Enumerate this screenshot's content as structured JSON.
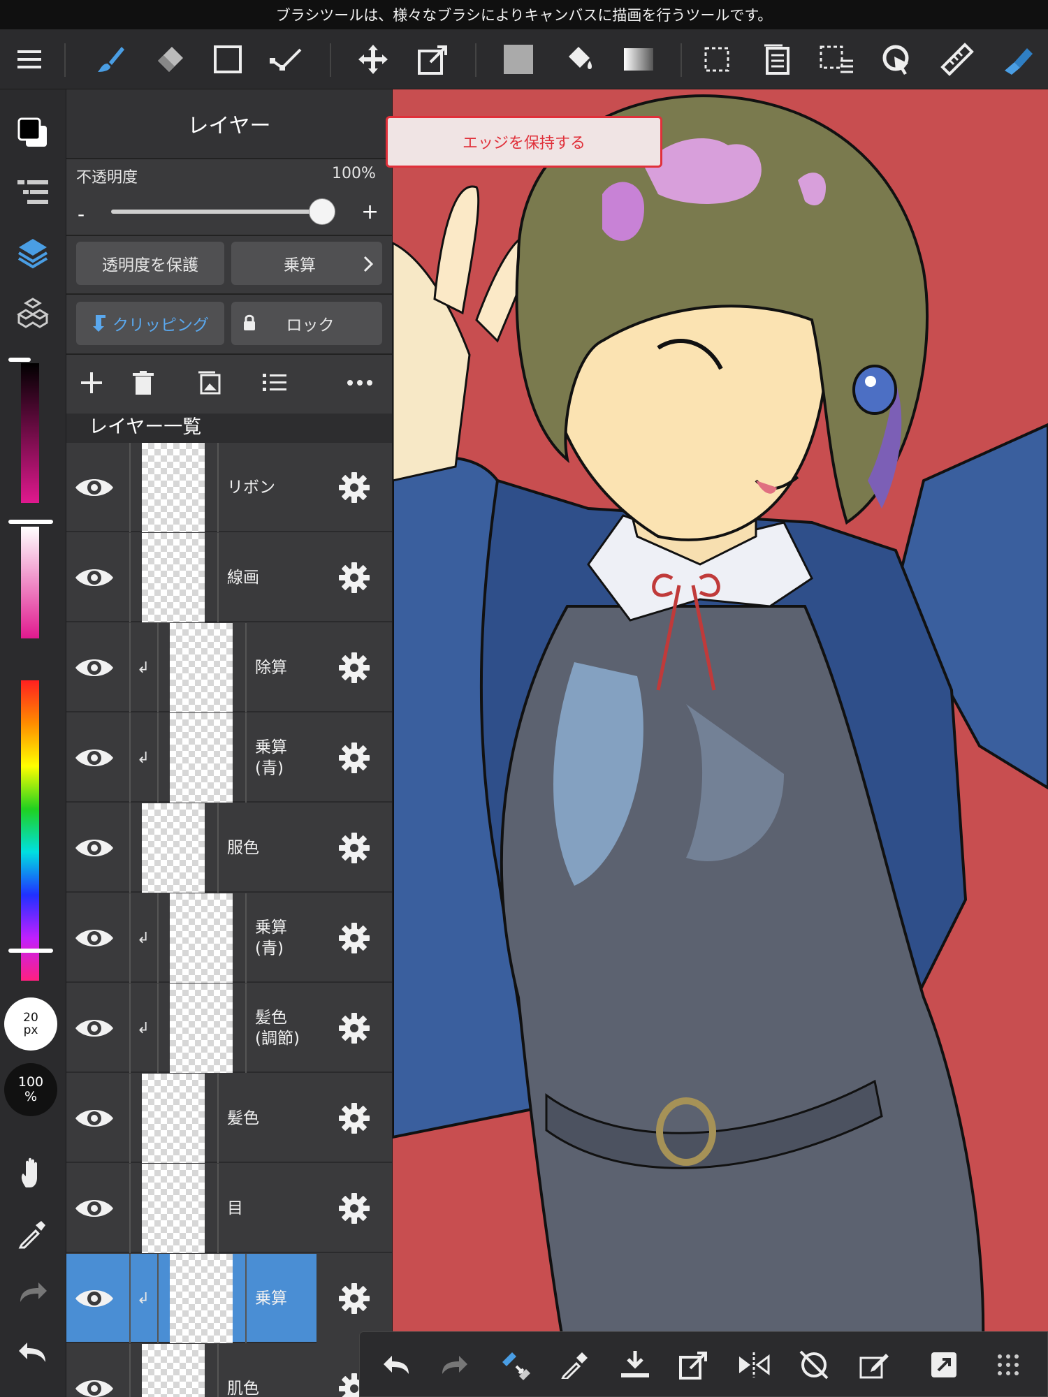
{
  "tip": "ブラシツールは、様々なブラシによりキャンバスに描画を行うツールです。",
  "toolbar": {
    "tools": [
      "menu-icon",
      "brush-icon",
      "eraser-icon",
      "rectangle-icon",
      "vertex-tool-icon",
      "move-icon",
      "transform-icon",
      "fill-color-icon",
      "bucket-icon",
      "gradient-icon",
      "select-rect-icon",
      "paste-icon",
      "selection-layer-icon",
      "lasso-icon",
      "ruler-icon",
      "current-brush-icon"
    ]
  },
  "panel": {
    "title": "レイヤー",
    "opacity_label": "不透明度",
    "opacity_value": "100%",
    "opacity_fraction": 1.0,
    "minus": "-",
    "plus": "+",
    "protect_alpha": "透明度を保護",
    "blend_mode": "乗算",
    "clipping": "クリッピング",
    "lock": "ロック",
    "list_title": "レイヤー一覧"
  },
  "layers": [
    {
      "name": "リボン",
      "clipped": false,
      "selected": false
    },
    {
      "name": "線画",
      "clipped": false,
      "selected": false
    },
    {
      "name": "除算",
      "clipped": true,
      "selected": false
    },
    {
      "name": "乗算\n(青)",
      "clipped": true,
      "selected": false
    },
    {
      "name": "服色",
      "clipped": false,
      "selected": false
    },
    {
      "name": "乗算\n(青)",
      "clipped": true,
      "selected": false
    },
    {
      "name": "髪色\n(調節)",
      "clipped": true,
      "selected": false
    },
    {
      "name": "髪色",
      "clipped": false,
      "selected": false
    },
    {
      "name": "目",
      "clipped": false,
      "selected": false
    },
    {
      "name": "乗算",
      "clipped": true,
      "selected": true
    },
    {
      "name": "肌色",
      "clipped": false,
      "selected": false
    }
  ],
  "brush_size": "20\npx",
  "brush_opacity": "100\n%",
  "edge_popup": "エッジを保持する",
  "colors": {
    "accent": "#4a8ed4",
    "canvas_bg": "#c84e50",
    "popup_red": "#e0303a"
  }
}
